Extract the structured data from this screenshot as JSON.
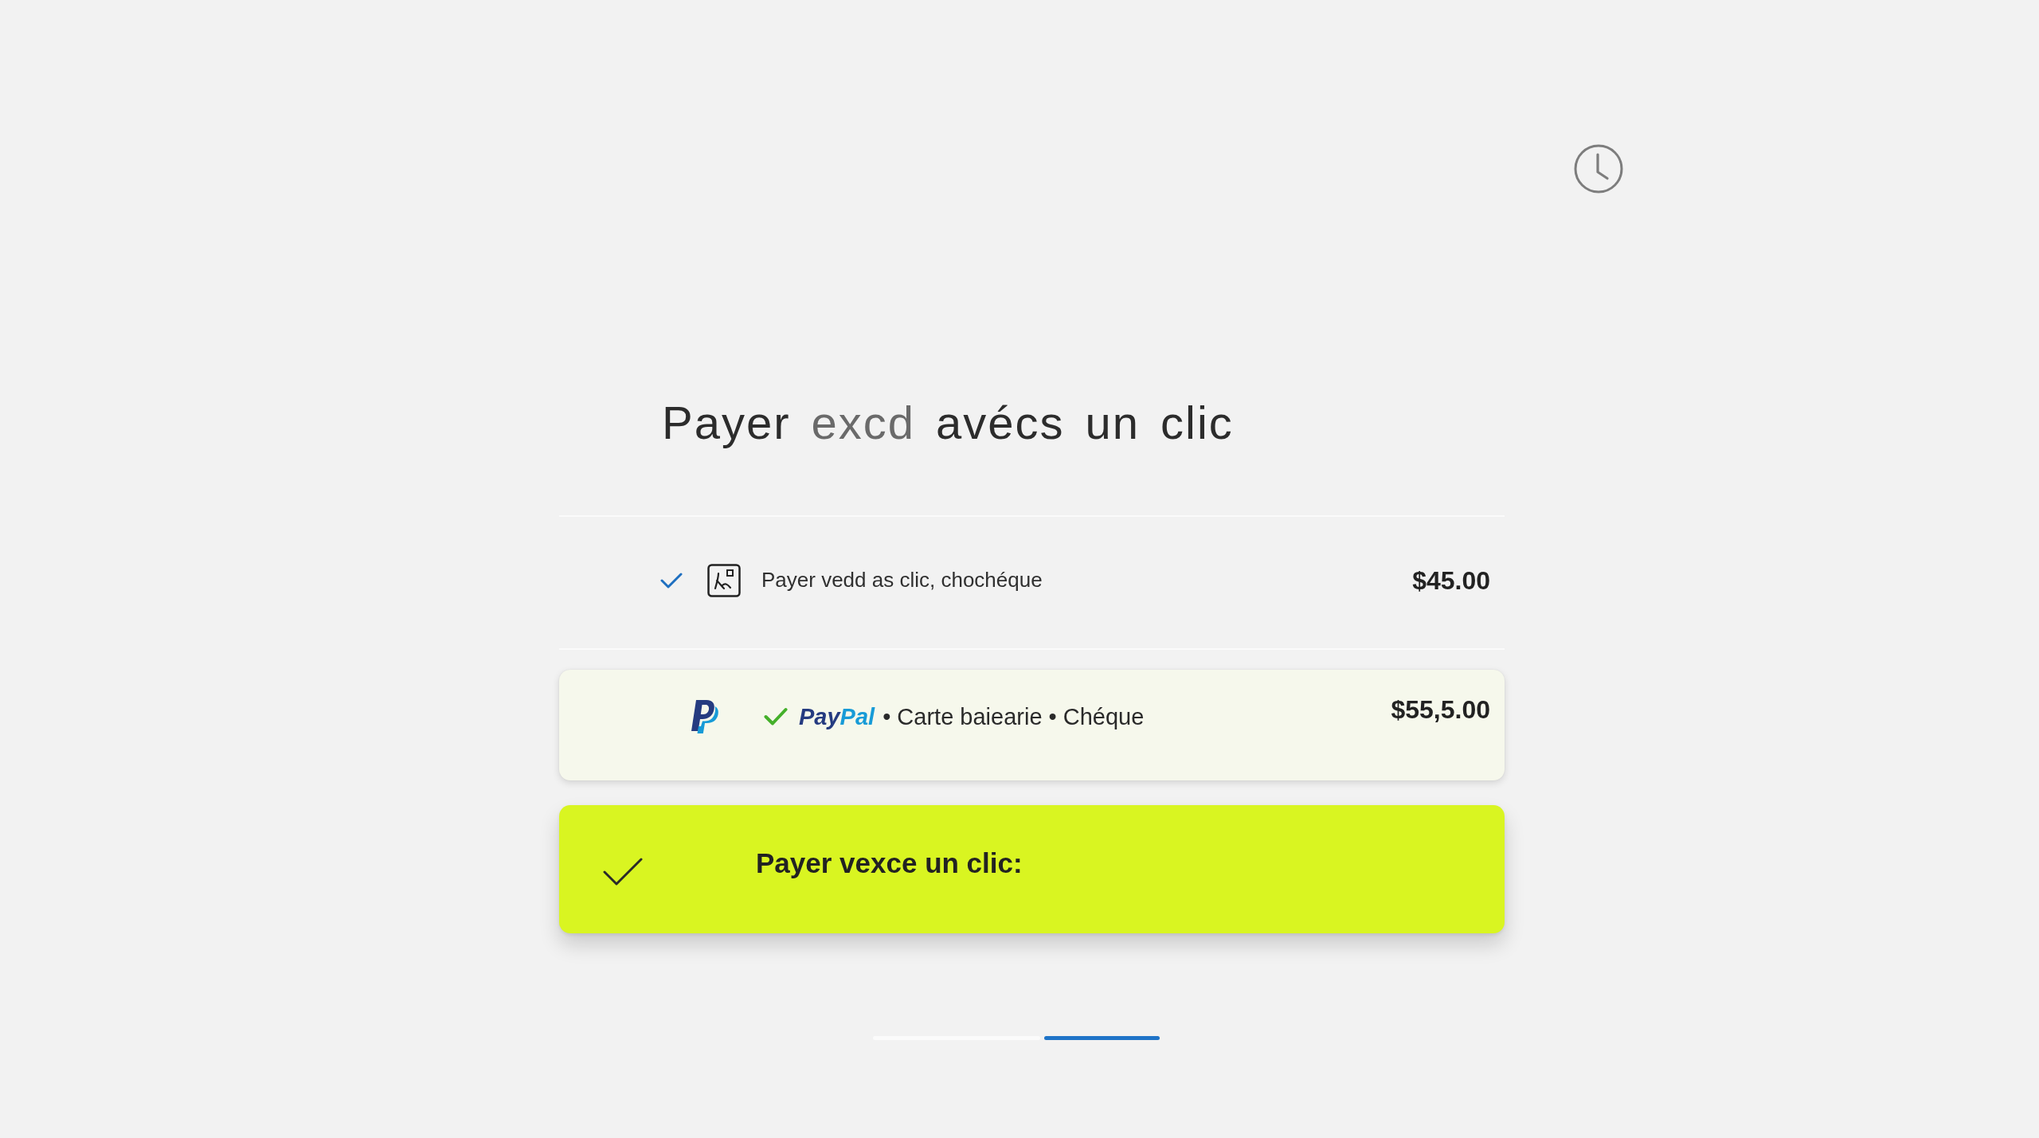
{
  "title": {
    "words": [
      {
        "text": "Payer",
        "muted": false
      },
      {
        "text": "excd",
        "muted": true
      },
      {
        "text": "avécs",
        "muted": false
      },
      {
        "text": "un",
        "muted": false
      },
      {
        "text": "clic",
        "muted": false
      }
    ]
  },
  "options": [
    {
      "kind": "method",
      "selected": false,
      "label": "Payer vedd as clic, chochéque",
      "price": "$45.00"
    },
    {
      "kind": "paypal",
      "selected": true,
      "brand": [
        "Pay",
        "Pal"
      ],
      "detail": "• Carte baiearie • Chéque",
      "price": "$55,5.00"
    }
  ],
  "action": {
    "label": "Payer vexce un clic:"
  },
  "steps": [
    {
      "selected": false
    },
    {
      "selected": true
    }
  ]
}
